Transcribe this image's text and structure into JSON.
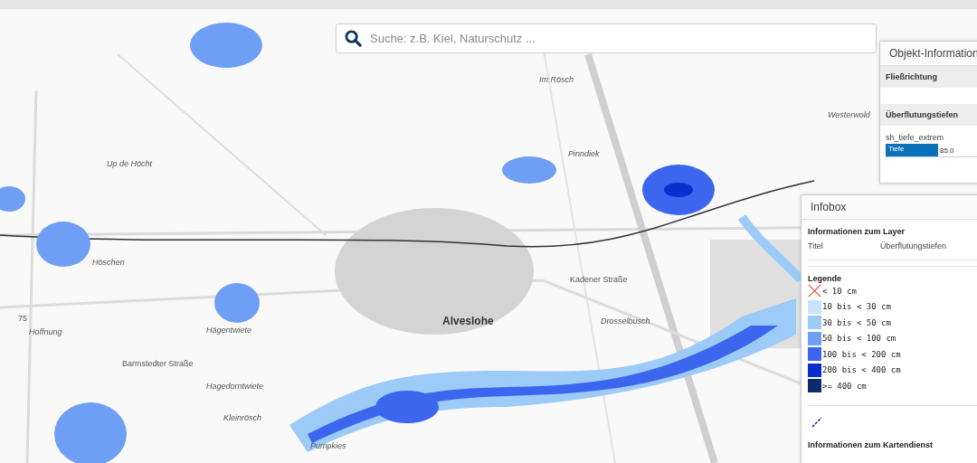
{
  "search": {
    "placeholder": "Suche: z.B. Kiel, Naturschutz ..."
  },
  "map_labels": [
    {
      "text": "Up de Höcht",
      "kind": "place"
    },
    {
      "text": "Höschen",
      "kind": "place"
    },
    {
      "text": "Hoffnung",
      "kind": "place"
    },
    {
      "text": "Hägentwiete",
      "kind": "place"
    },
    {
      "text": "Barmstedter Straße",
      "kind": "street"
    },
    {
      "text": "Hagedorntwiete",
      "kind": "place"
    },
    {
      "text": "Kleinrösch",
      "kind": "place"
    },
    {
      "text": "Pumpkies",
      "kind": "place"
    },
    {
      "text": "Alveslohe",
      "kind": "town"
    },
    {
      "text": "Im Rösch",
      "kind": "place"
    },
    {
      "text": "Pinndiek",
      "kind": "place"
    },
    {
      "text": "Kadener Straße",
      "kind": "street"
    },
    {
      "text": "Drosselbusch",
      "kind": "place"
    },
    {
      "text": "Westerwold",
      "kind": "place"
    },
    {
      "text": "75",
      "kind": "street"
    }
  ],
  "object_info": {
    "title": "Objekt-Information",
    "sections": [
      {
        "heading": "Fließrichtung"
      },
      {
        "heading": "Überflutungstiefen",
        "layer": "sh_tiefe_extrem",
        "field": "Tiefe",
        "value": "85.0"
      }
    ]
  },
  "infobox": {
    "title": "Infobox",
    "layer_heading": "Informationen zum Layer",
    "title_label": "Titel",
    "title_value": "Überflutungstiefen",
    "legend_heading": "Legende",
    "legend": [
      {
        "label": "< 10 cm",
        "kind": "cross",
        "color": "#e04848"
      },
      {
        "label": "10 bis < 30 cm",
        "kind": "swatch",
        "color": "#c8e3fb"
      },
      {
        "label": "30 bis < 50 cm",
        "kind": "swatch",
        "color": "#9dcbf8"
      },
      {
        "label": "50 bis < 100 cm",
        "kind": "swatch",
        "color": "#6e9ff5"
      },
      {
        "label": "100 bis < 200 cm",
        "kind": "swatch",
        "color": "#3d66ef"
      },
      {
        "label": "200 bis < 400 cm",
        "kind": "swatch",
        "color": "#0b2fcf"
      },
      {
        "label": ">= 400 cm",
        "kind": "swatch",
        "color": "#0a2a6a"
      }
    ],
    "service_heading": "Informationen zum Kartendienst"
  }
}
